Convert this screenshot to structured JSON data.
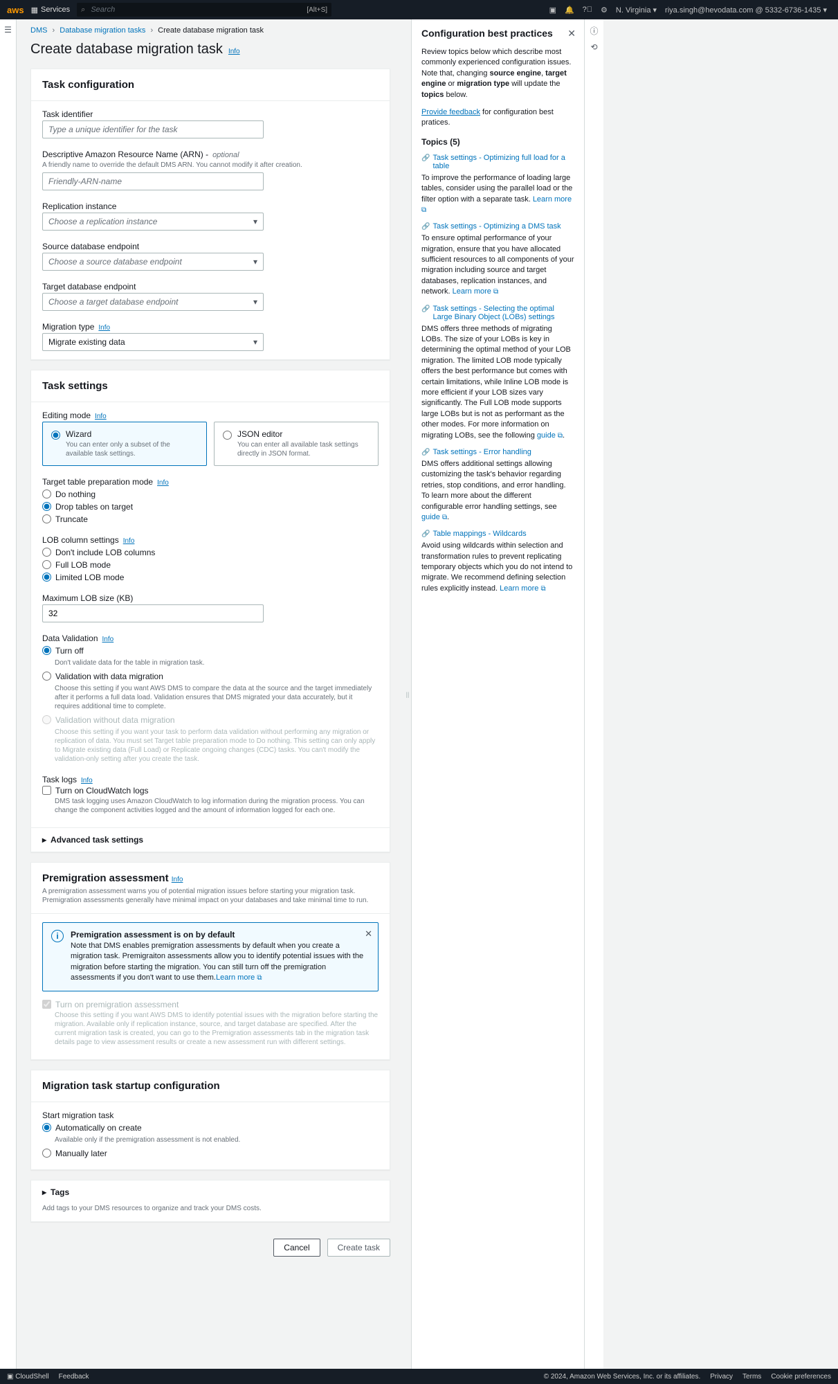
{
  "topnav": {
    "logo": "aws",
    "services": "Services",
    "searchPlaceholder": "Search",
    "searchKbd": "[Alt+S]",
    "region": "N. Virginia",
    "account": "riya.singh@hevodata.com @ 5332-6736-1435"
  },
  "breadcrumbs": {
    "items": [
      "DMS",
      "Database migration tasks",
      "Create database migration task"
    ]
  },
  "page": {
    "title": "Create database migration task",
    "infoLabel": "Info"
  },
  "taskConfig": {
    "heading": "Task configuration",
    "fields": {
      "identifier": {
        "label": "Task identifier",
        "placeholder": "Type a unique identifier for the task"
      },
      "arn": {
        "label": "Descriptive Amazon Resource Name (ARN) -",
        "optional": "optional",
        "desc": "A friendly name to override the default DMS ARN. You cannot modify it after creation.",
        "placeholder": "Friendly-ARN-name"
      },
      "replication": {
        "label": "Replication instance",
        "placeholder": "Choose a replication instance"
      },
      "source": {
        "label": "Source database endpoint",
        "placeholder": "Choose a source database endpoint"
      },
      "target": {
        "label": "Target database endpoint",
        "placeholder": "Choose a target database endpoint"
      },
      "migrationType": {
        "label": "Migration type",
        "value": "Migrate existing data"
      }
    }
  },
  "taskSettings": {
    "heading": "Task settings",
    "editingMode": {
      "label": "Editing mode",
      "wizard": {
        "title": "Wizard",
        "desc": "You can enter only a subset of the available task settings."
      },
      "json": {
        "title": "JSON editor",
        "desc": "You can enter all available task settings directly in JSON format."
      }
    },
    "tablePrep": {
      "label": "Target table preparation mode",
      "opts": [
        "Do nothing",
        "Drop tables on target",
        "Truncate"
      ]
    },
    "lobCol": {
      "label": "LOB column settings",
      "opts": [
        "Don't include LOB columns",
        "Full LOB mode",
        "Limited LOB mode"
      ]
    },
    "maxLob": {
      "label": "Maximum LOB size (KB)",
      "value": "32"
    },
    "validation": {
      "label": "Data Validation",
      "opt1": {
        "title": "Turn off",
        "desc": "Don't validate data for the table in migration task."
      },
      "opt2": {
        "title": "Validation with data migration",
        "desc": "Choose this setting if you want AWS DMS to compare the data at the source and the target immediately after it performs a full data load. Validation ensures that DMS migrated your data accurately, but it requires additional time to complete."
      },
      "opt3": {
        "title": "Validation without data migration",
        "desc": "Choose this setting if you want your task to perform data validation without performing any migration or replication of data. You must set Target table preparation mode to Do nothing. This setting can only apply to Migrate existing data (Full Load) or Replicate ongoing changes (CDC) tasks. You can't modify the validation-only setting after you create the task."
      }
    },
    "taskLogs": {
      "label": "Task logs",
      "check": "Turn on CloudWatch logs",
      "desc": "DMS task logging uses Amazon CloudWatch to log information during the migration process. You can change the component activities logged and the amount of information logged for each one."
    },
    "advanced": "Advanced task settings"
  },
  "premigration": {
    "heading": "Premigration assessment",
    "desc": "A premigration assessment warns you of potential migration issues before starting your migration task. Premigration assessments generally have minimal impact on your databases and take minimal time to run.",
    "alert": {
      "title": "Premigration assessment is on by default",
      "body": "Note that DMS enables premigration assessments by default when you create a migration task. Premigraiton assessments allow you to identify potential issues with the migration before starting the migration. You can still turn off the premigration assessments if you don't want to use them.",
      "learnMore": "Learn more"
    },
    "check": "Turn on premigration assessment",
    "checkDesc": "Choose this setting if you want AWS DMS to identify potential issues with the migration before starting the migration. Available only if replication instance, source, and target database are specified. After the current migration task is created, you can go to the Premigration assessments tab in the migration task details page to view assessment results or create a new assessment run with different settings."
  },
  "startup": {
    "heading": "Migration task startup configuration",
    "label": "Start migration task",
    "opt1": {
      "title": "Automatically on create",
      "desc": "Available only if the premigration assessment is not enabled."
    },
    "opt2": "Manually later"
  },
  "tags": {
    "heading": "Tags",
    "desc": "Add tags to your DMS resources to organize and track your DMS costs."
  },
  "actions": {
    "cancel": "Cancel",
    "create": "Create task"
  },
  "helpPanel": {
    "title": "Configuration best practices",
    "intro1": "Review topics below which describe most commonly experienced configuration issues. Note that, changing ",
    "intro1b": "source engine",
    "intro1c": ", ",
    "intro1d": "target engine",
    "intro1e": " or ",
    "intro1f": "migration type",
    "intro1g": " will update the ",
    "intro1h": "topics",
    "intro1i": " below.",
    "feedback": "Provide feedback",
    "feedbackRest": " for configuration best pratices.",
    "topicsHeading": "Topics (5)",
    "topics": [
      {
        "title": "Task settings - Optimizing full load for a table",
        "body": "To improve the performance of loading large tables, consider using the parallel load or the filter option with a separate task. ",
        "link": "Learn more"
      },
      {
        "title": "Task settings - Optimizing a DMS task",
        "body": "To ensure optimal performance of your migration, ensure that you have allocated sufficient resources to all components of your migration including source and target databases, replication instances, and network. ",
        "link": "Learn more"
      },
      {
        "title": "Task settings - Selecting the optimal Large Binary Object (LOBs) settings",
        "body": "DMS offers three methods of migrating LOBs. The size of your LOBs is key in determining the optimal method of your LOB migration. The limited LOB mode typically offers the best performance but comes with certain limitations, while Inline LOB mode is more efficient if your LOB sizes vary significantly. The Full LOB mode supports large LOBs but is not as performant as the other modes. For more information on migrating LOBs, see the following ",
        "link": "guide"
      },
      {
        "title": "Task settings - Error handling",
        "body": "DMS offers additional settings allowing customizing the task's behavior regarding retries, stop conditions, and error handling. To learn more about the different configurable error handling settings, see ",
        "link": "guide"
      },
      {
        "title": "Table mappings - Wildcards",
        "body": "Avoid using wildcards within selection and transformation rules to prevent replicating temporary objects which you do not intend to migrate. We recommend defining selection rules explicitly instead. ",
        "link": "Learn more"
      }
    ]
  },
  "footer": {
    "cloudshell": "CloudShell",
    "feedback": "Feedback",
    "copyright": "© 2024, Amazon Web Services, Inc. or its affiliates.",
    "links": [
      "Privacy",
      "Terms",
      "Cookie preferences"
    ]
  }
}
